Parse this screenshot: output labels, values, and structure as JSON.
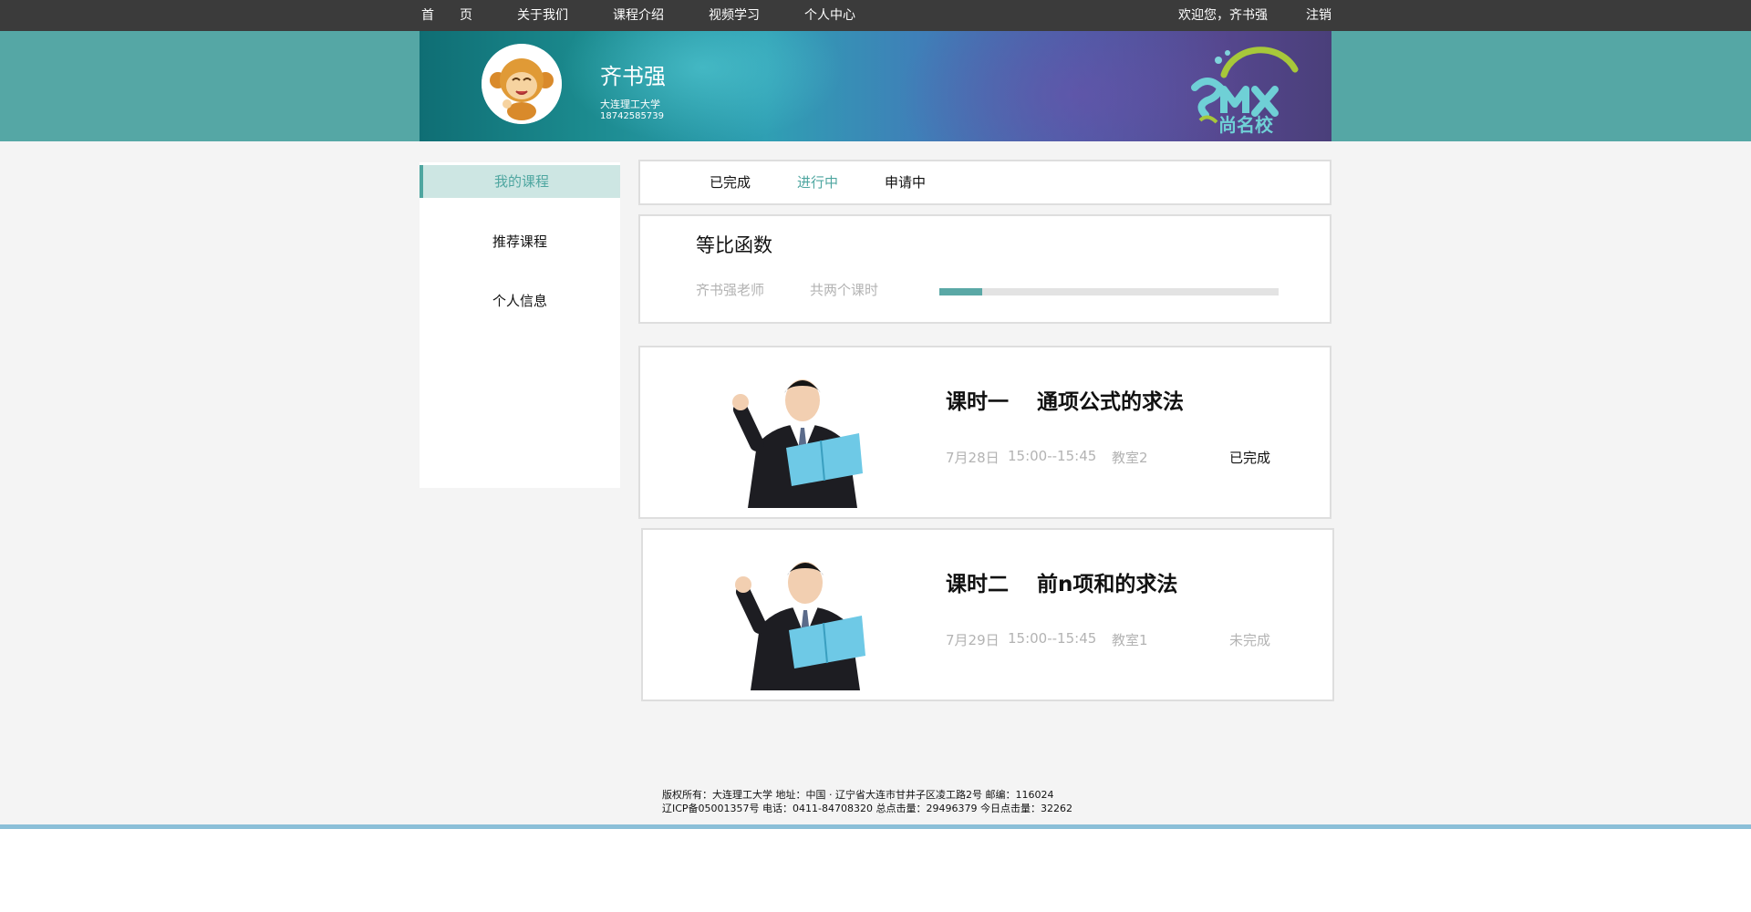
{
  "nav": {
    "home": "首　　页",
    "about": "关于我们",
    "courses": "课程介绍",
    "video": "视频学习",
    "personal": "个人中心",
    "welcome": "欢迎您，齐书强",
    "logout": "注销"
  },
  "profile": {
    "name": "齐书强",
    "school": "大连理工大学",
    "phone": "18742585739"
  },
  "logo": {
    "text": "尚名校",
    "latin": "SMX"
  },
  "sidebar": {
    "items": [
      {
        "label": "我的课程",
        "active": true
      },
      {
        "label": "推荐课程",
        "active": false
      },
      {
        "label": "个人信息",
        "active": false
      }
    ]
  },
  "tabs": [
    {
      "label": "已完成",
      "active": false
    },
    {
      "label": "进行中",
      "active": true
    },
    {
      "label": "申请中",
      "active": false
    }
  ],
  "course": {
    "title": "等比函数",
    "teacher": "齐书强老师",
    "lessons_total": "共两个课时",
    "progress": 0.125
  },
  "lessons": [
    {
      "title": "课时一　 通项公式的求法",
      "date": "7月28日",
      "time": "15:00--15:45",
      "room": "教室2",
      "status": "已完成",
      "done": true
    },
    {
      "title": "课时二　 前n项和的求法",
      "date": "7月29日",
      "time": "15:00--15:45",
      "room": "教室1",
      "status": "未完成",
      "done": false
    }
  ],
  "footer": {
    "line1": "版权所有：大连理工大学  地址：中国 · 辽宁省大连市甘井子区凌工路2号  邮编：116024",
    "line2": "辽ICP备05001357号  电话：0411-84708320 总点击量：29496379 今日点击量：32262"
  },
  "colors": {
    "accent": "#4ea6a0",
    "topbar": "#3b3b3b",
    "banner_strip": "#55a7a5",
    "page_bg": "#f4f4f4"
  }
}
